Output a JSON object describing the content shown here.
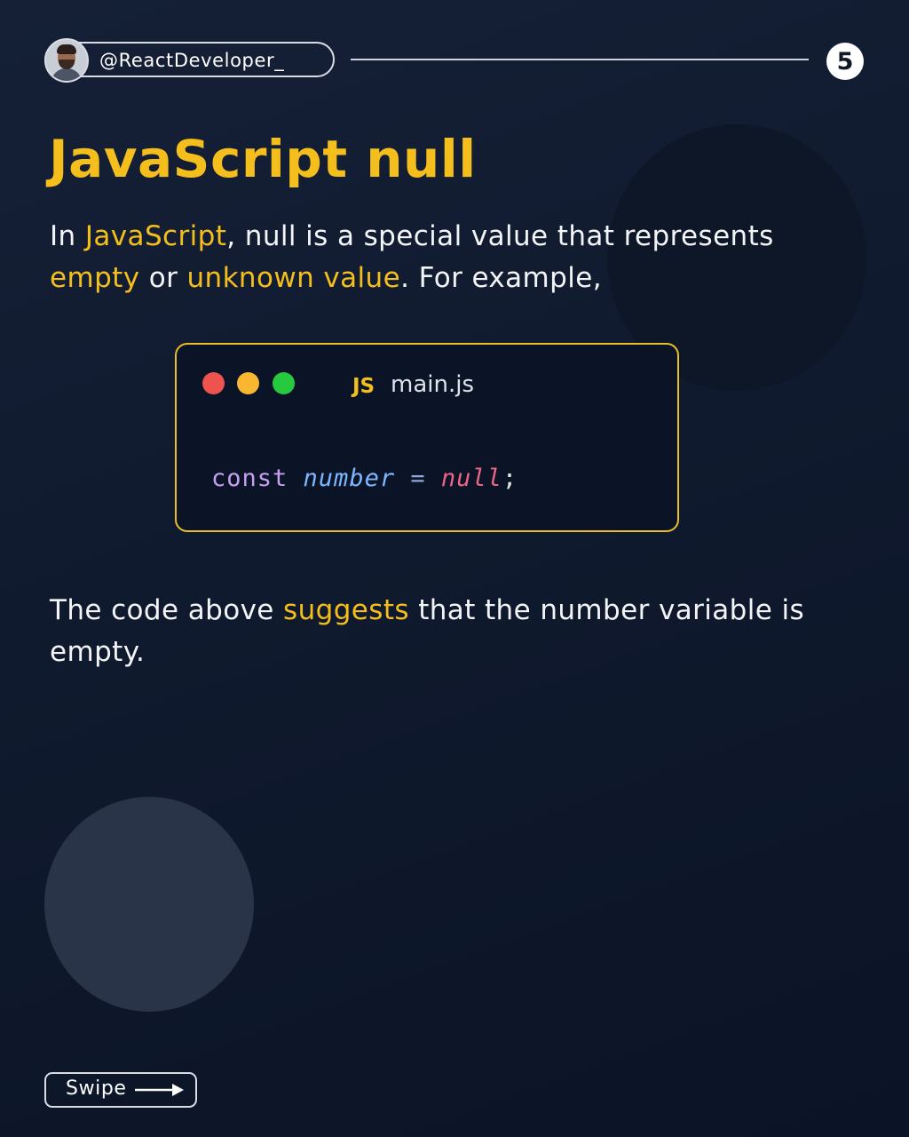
{
  "header": {
    "handle": "@ReactDeveloper_",
    "page_number": "5"
  },
  "title": "JavaScript null",
  "intro": {
    "s1": "In ",
    "s2": "JavaScript",
    "s3": ", null is a special value that represents ",
    "s4": "empty",
    "s5": " or ",
    "s6": "unknown value",
    "s7": ". For example,"
  },
  "code_window": {
    "js_badge": "JS",
    "filename": "main.js",
    "code": {
      "keyword": "const",
      "variable": "number",
      "operator": "=",
      "value": "null",
      "terminator": ";"
    }
  },
  "explanation": {
    "s1": "The code above ",
    "s2": "suggests",
    "s3": " that the number variable is empty."
  },
  "footer": {
    "swipe_label": "Swipe"
  },
  "colors": {
    "accent": "#f4bf1c",
    "background": "#101a2e",
    "code_border": "#e8bf2a"
  }
}
